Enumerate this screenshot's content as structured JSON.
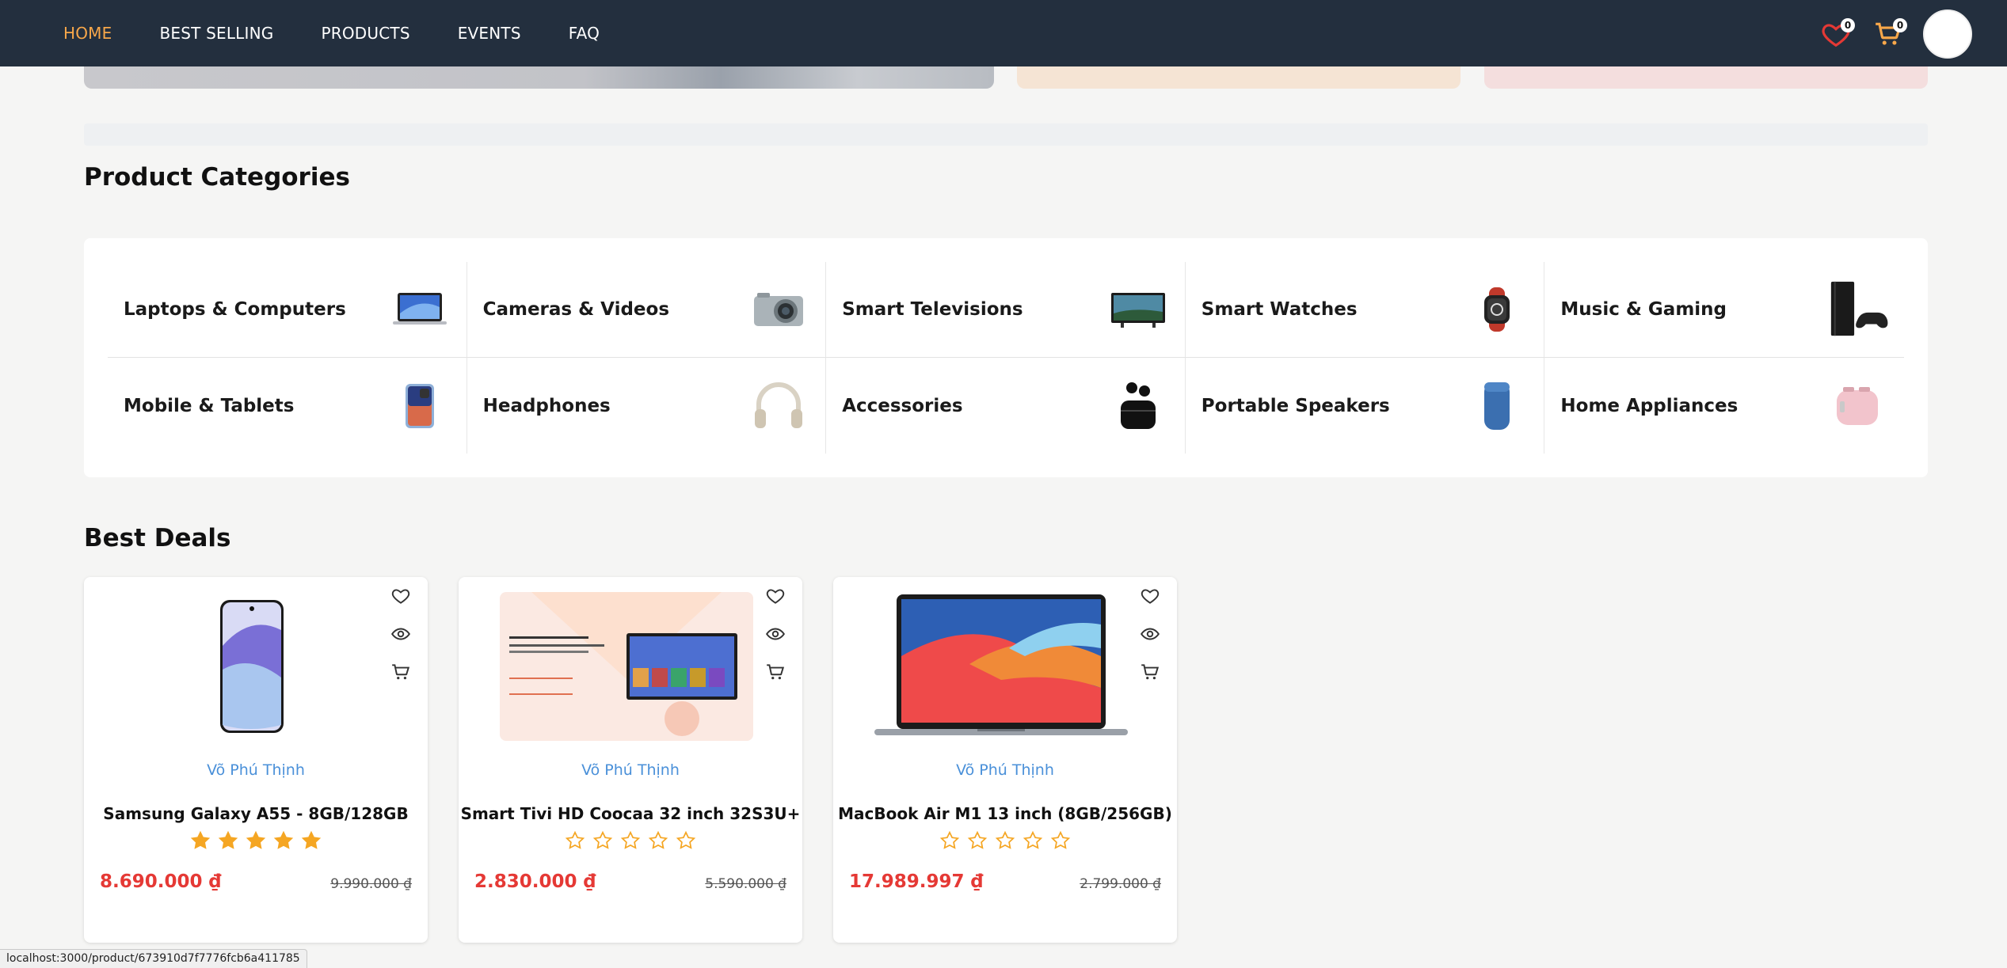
{
  "nav": {
    "links": [
      "HOME",
      "BEST SELLING",
      "PRODUCTS",
      "EVENTS",
      "FAQ"
    ],
    "active": "HOME",
    "wishlist_count": "0",
    "cart_count": "0"
  },
  "categories": {
    "title": "Product Categories",
    "items": [
      {
        "label": "Laptops & Computers",
        "icon": "laptop-icon"
      },
      {
        "label": "Cameras & Videos",
        "icon": "camera-icon"
      },
      {
        "label": "Smart Televisions",
        "icon": "tv-icon"
      },
      {
        "label": "Smart Watches",
        "icon": "watch-icon"
      },
      {
        "label": "Music & Gaming",
        "icon": "console-icon"
      },
      {
        "label": "Mobile & Tablets",
        "icon": "phone-icon"
      },
      {
        "label": "Headphones",
        "icon": "headphones-icon"
      },
      {
        "label": "Accessories",
        "icon": "earbuds-icon"
      },
      {
        "label": "Portable Speakers",
        "icon": "speaker-icon"
      },
      {
        "label": "Home Appliances",
        "icon": "toaster-icon"
      }
    ]
  },
  "deals": {
    "title": "Best Deals",
    "products": [
      {
        "seller": "Võ Phú Thịnh",
        "name": "Samsung Galaxy A55 - 8GB/128GB",
        "rating": 5,
        "price": "8.690.000 ₫",
        "old_price": "9.990.000 ₫",
        "image": "phone-image"
      },
      {
        "seller": "Võ Phú Thịnh",
        "name": "Smart Tivi HD Coocaa 32 inch 32S3U+",
        "rating": 0,
        "price": "2.830.000 ₫",
        "old_price": "5.590.000 ₫",
        "image": "tv-image"
      },
      {
        "seller": "Võ Phú Thịnh",
        "name": "MacBook Air M1 13 inch (8GB/256GB)",
        "rating": 0,
        "price": "17.989.997 ₫",
        "old_price": "2.799.000 ₫",
        "image": "laptop-image"
      }
    ]
  },
  "status_url": "localhost:3000/product/673910d7f7776fcb6a411785",
  "colors": {
    "nav_bg": "#232f3e",
    "active_link": "#f7a74a",
    "price": "#e53935",
    "seller": "#4a90d9",
    "star": "#f5a623"
  }
}
